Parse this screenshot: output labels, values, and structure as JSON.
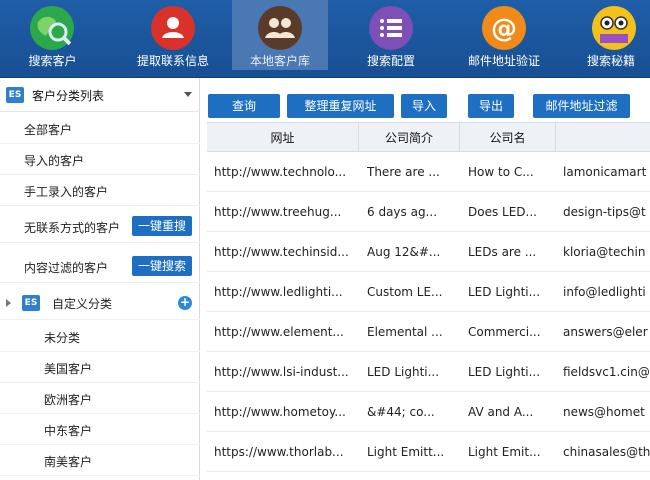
{
  "nav": [
    {
      "label": "搜索客户",
      "icon": "globe-search-icon",
      "color": "#2aa84a"
    },
    {
      "label": "提取联系信息",
      "icon": "contact-card-icon",
      "color": "#d9322b"
    },
    {
      "label": "本地客户库",
      "icon": "user-group-icon",
      "color": "#5a3b2a"
    },
    {
      "label": "搜索配置",
      "icon": "list-settings-icon",
      "color": "#7e4fb6"
    },
    {
      "label": "邮件地址验证",
      "icon": "at-sign-icon",
      "color": "#f08a18"
    },
    {
      "label": "搜索秘籍",
      "icon": "book-owl-icon",
      "color": "#f2c21b"
    }
  ],
  "sidebar": {
    "header": {
      "badge": "ES",
      "title": "客户分类列表"
    },
    "items": [
      {
        "label": "全部客户"
      },
      {
        "label": "导入的客户"
      },
      {
        "label": "手工录入的客户"
      },
      {
        "label": "无联系方式的客户",
        "button": "一键重搜"
      },
      {
        "label": "内容过滤的客户",
        "button": "一键搜索"
      }
    ],
    "custom_group": {
      "badge": "ES",
      "label": "自定义分类",
      "add": "+"
    },
    "custom_items": [
      {
        "label": "未分类"
      },
      {
        "label": "美国客户"
      },
      {
        "label": "欧洲客户"
      },
      {
        "label": "中东客户"
      },
      {
        "label": "南美客户"
      }
    ]
  },
  "toolbar": {
    "buttons": [
      "查询",
      "整理重复网址",
      "导入",
      "导出",
      "邮件地址过滤"
    ]
  },
  "table": {
    "columns": [
      "网址",
      "公司简介",
      "公司名",
      ""
    ],
    "rows": [
      [
        "http://www.technolo...",
        "There are ...",
        "How to C...",
        "lamonicamart"
      ],
      [
        "http://www.treehug...",
        "6 days ag...",
        "Does LED...",
        "design-tips@t"
      ],
      [
        "http://www.techinsid...",
        "Aug 12&#...",
        "LEDs are ...",
        "kloria@techin"
      ],
      [
        "http://www.ledlighti...",
        "Custom LE...",
        "LED Lighti...",
        "info@ledlighti"
      ],
      [
        "http://www.element...",
        "Elemental ...",
        "Commerci...",
        "answers@eler"
      ],
      [
        "http://www.lsi-indust...",
        "LED Lighti...",
        "LED Lighti...",
        "fieldsvc1.cin@"
      ],
      [
        "http://www.hometoy...",
        "&#44; co...",
        "AV and A...",
        "news@homet"
      ],
      [
        "https://www.thorlab...",
        "Light Emitt...",
        "Light Emit...",
        "chinasales@th"
      ]
    ]
  }
}
